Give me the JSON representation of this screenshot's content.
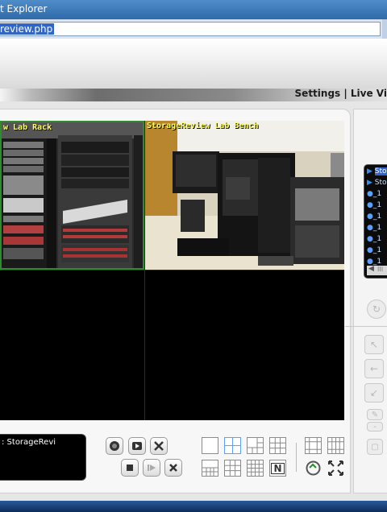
{
  "window": {
    "title": "t Explorer"
  },
  "address_bar": {
    "url": "review.php"
  },
  "nav": {
    "text": "Settings  |  Live Vi"
  },
  "cameras": [
    {
      "label": "w Lab Rack"
    },
    {
      "label": "StorageReview Lab Bench"
    },
    {
      "label": ""
    },
    {
      "label": ""
    }
  ],
  "channel_list": {
    "items": [
      "Sto",
      "Sto",
      "_1",
      "_1",
      "_1",
      "_1",
      "_1",
      "_1",
      "_1"
    ],
    "scroll_label": "III"
  },
  "info_box": {
    "text": ": StorageRevi"
  },
  "icons": {
    "record": "record-icon",
    "playback": "playback-icon",
    "tools": "tools-icon",
    "stop": "stop-icon",
    "step": "step-forward-icon",
    "close": "close-icon"
  },
  "layout_buttons": [
    "1x1",
    "2x2",
    "1+5",
    "3x3",
    "1+7",
    "3x3-alt",
    "4x4",
    "N",
    "custom",
    "fullscreen"
  ],
  "ptz": {
    "minus": "-",
    "plus": "+"
  },
  "colors": {
    "accent": "#3166c5",
    "label": "#ffff66"
  }
}
